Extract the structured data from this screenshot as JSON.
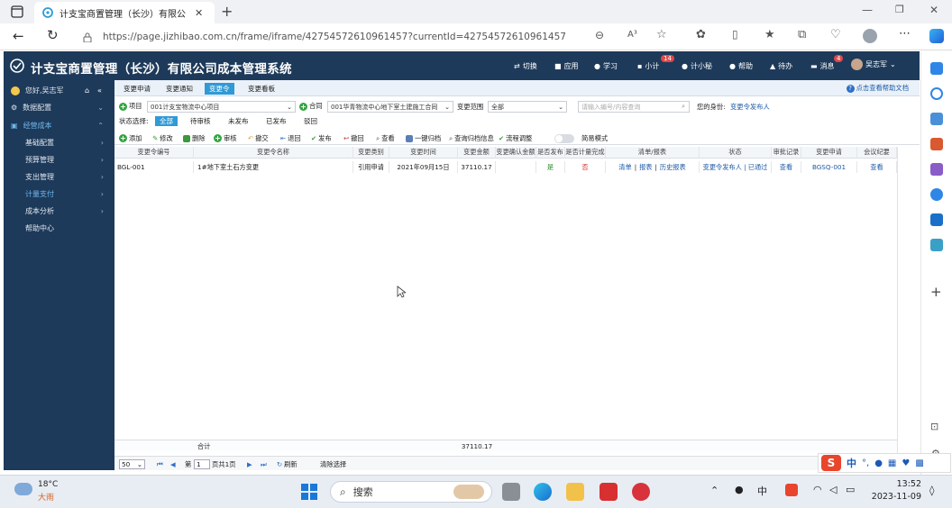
{
  "browser": {
    "tab_title": "计支宝商置管理（长沙）有限公",
    "url": "https://page.jizhibao.com.cn/frame/iframe/42754572610961457?currentId=42754572610961457",
    "read_aloud": "A³"
  },
  "app": {
    "title": "计支宝商置管理（长沙）有限公司成本管理系统",
    "nav": {
      "switch": "切换",
      "apps": "应用",
      "learn": "学习",
      "xiaoji": "小计",
      "xiaoji_badge": "14",
      "jixiaomi": "计小秘",
      "help": "帮助",
      "todo": "待办",
      "messages": "消息",
      "messages_badge": "4",
      "user": "吴志军"
    }
  },
  "sidebar": {
    "greeting": "您好,吴志军",
    "items": [
      {
        "label": "数据配置"
      },
      {
        "label": "经营成本"
      },
      {
        "label": "基础配置"
      },
      {
        "label": "预算管理"
      },
      {
        "label": "支出管理"
      },
      {
        "label": "计量支付"
      },
      {
        "label": "成本分析"
      },
      {
        "label": "帮助中心"
      }
    ]
  },
  "subtabs": [
    "变更申请",
    "变更通知",
    "变更令",
    "变更看板"
  ],
  "help_link": "点击查看帮助文档",
  "filter": {
    "project_label": "项目",
    "project_value": "001计支宝物流中心项目",
    "contract_label": "合同",
    "contract_value": "001华青物流中心地下室土建施工合同",
    "scope_label": "变更范围",
    "scope_value": "全部",
    "search_placeholder": "请输入编号/内容查询",
    "current_label": "您的身份:",
    "current_value": "变更令发布人"
  },
  "state": {
    "label": "状态选择:",
    "options": [
      "全部",
      "待审核",
      "未发布",
      "已发布",
      "驳回"
    ]
  },
  "toolbar": [
    "添加",
    "修改",
    "删除",
    "审核",
    "撤交",
    "退回",
    "发布",
    "撤回",
    "查看",
    "一键归档",
    "查询归档信息",
    "流程调整",
    "简易模式"
  ],
  "grid": {
    "headers": [
      "变更令编号",
      "变更令名称",
      "变更类别",
      "变更时间",
      "变更金额",
      "变更确认金额",
      "是否发布",
      "是否计量完成",
      "清单/报表",
      "状态",
      "审批记录",
      "变更申请",
      "会议纪要"
    ],
    "rows": [
      {
        "code": "BGL-001",
        "name": "1#地下室土石方变更",
        "category": "引用申请",
        "time": "2021年09月15日",
        "amount": "37110.17",
        "confirm": "",
        "published": "是",
        "measured": "否",
        "list": "清单",
        "report": "报表",
        "history": "历史报表",
        "status": "变更令发布人 | 已通过",
        "approval": "查看",
        "apply": "BGSQ-001",
        "meeting": "查看"
      }
    ],
    "sum_label": "合计",
    "sum_amount": "37110.17"
  },
  "pager": {
    "page_size": "50",
    "page_input": "1",
    "page_text": "页共1页",
    "refresh": "刷新",
    "clear": "清除选择"
  },
  "taskbar": {
    "weather_temp": "18°C",
    "weather_desc": "大雨",
    "search": "搜索",
    "ime": "中",
    "time": "13:52",
    "date": "2023-11-09"
  },
  "ime_bar": {
    "mode": "中"
  },
  "colors": {
    "header": "#1e3a5a",
    "accent": "#2f9ad6",
    "link": "#1c5aa6",
    "red": "#e04848"
  }
}
